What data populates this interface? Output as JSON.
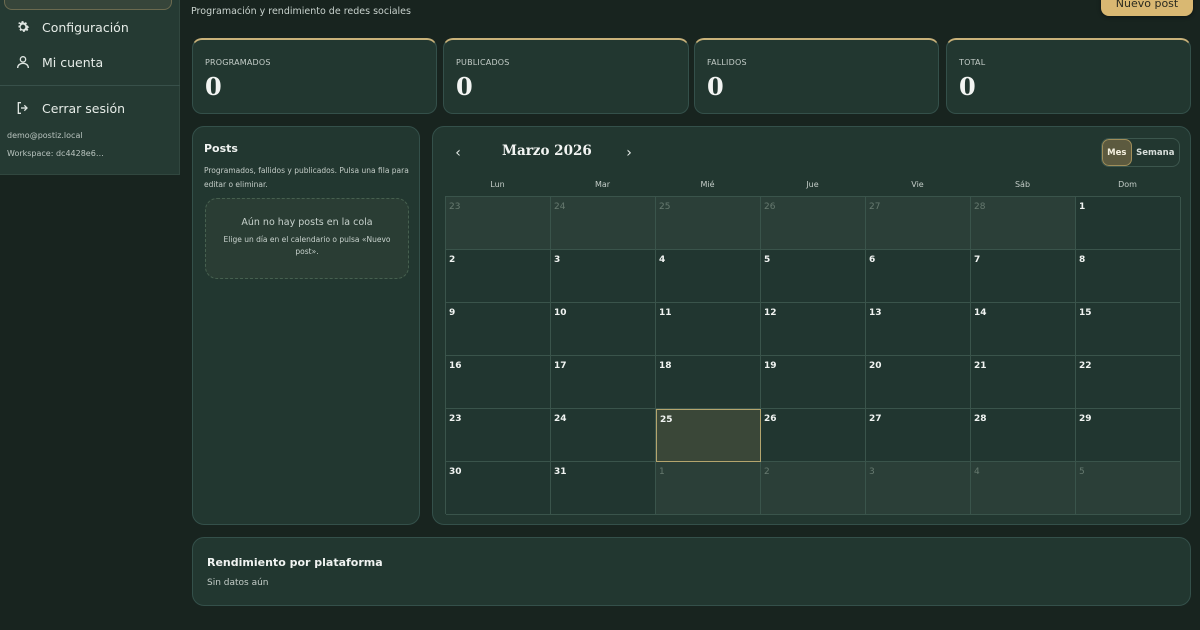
{
  "sidebar": {
    "nav": [
      {
        "label": "Configuración",
        "icon": "gear-icon"
      },
      {
        "label": "Mi cuenta",
        "icon": "user-icon"
      },
      {
        "label": "Cerrar sesión",
        "icon": "logout-icon"
      }
    ],
    "email": "demo@postiz.local",
    "workspace": "Workspace: dc4428e6…"
  },
  "header": {
    "subtitle": "Programación y rendimiento de redes sociales",
    "new_post_label": "Nuevo post"
  },
  "stats": [
    {
      "label": "PROGRAMADOS",
      "value": "0"
    },
    {
      "label": "PUBLICADOS",
      "value": "0"
    },
    {
      "label": "FALLIDOS",
      "value": "0"
    },
    {
      "label": "TOTAL",
      "value": "0"
    }
  ],
  "posts": {
    "title": "Posts",
    "description": "Programados, fallidos y publicados. Pulsa una fila para editar o eliminar.",
    "empty_title": "Aún no hay posts en la cola",
    "empty_desc": "Elige un día en el calendario o pulsa «Nuevo post»."
  },
  "calendar": {
    "month": "Marzo 2026",
    "prev_icon": "chevron-left-icon",
    "next_icon": "chevron-right-icon",
    "views": [
      "Mes",
      "Semana"
    ],
    "active_view": "Mes",
    "weekdays": [
      "Lun",
      "Mar",
      "Mié",
      "Jue",
      "Vie",
      "Sáb",
      "Dom"
    ],
    "weeks": [
      [
        "23",
        "24",
        "25",
        "26",
        "27",
        "28",
        "1"
      ],
      [
        "2",
        "3",
        "4",
        "5",
        "6",
        "7",
        "8"
      ],
      [
        "9",
        "10",
        "11",
        "12",
        "13",
        "14",
        "15"
      ],
      [
        "16",
        "17",
        "18",
        "19",
        "20",
        "21",
        "22"
      ],
      [
        "23",
        "24",
        "25",
        "26",
        "27",
        "28",
        "29"
      ],
      [
        "30",
        "31",
        "1",
        "2",
        "3",
        "4",
        "5"
      ]
    ],
    "other_month": [
      [
        true,
        true,
        true,
        true,
        true,
        true,
        false
      ],
      [
        false,
        false,
        false,
        false,
        false,
        false,
        false
      ],
      [
        false,
        false,
        false,
        false,
        false,
        false,
        false
      ],
      [
        false,
        false,
        false,
        false,
        false,
        false,
        false
      ],
      [
        false,
        false,
        false,
        false,
        false,
        false,
        false
      ],
      [
        false,
        false,
        true,
        true,
        true,
        true,
        true
      ]
    ],
    "today": "25"
  },
  "performance": {
    "title": "Rendimiento por plataforma",
    "empty": "Sin datos aún"
  },
  "colors": {
    "accent": "#d9b872",
    "background": "#18241f",
    "panel": "#223730"
  }
}
